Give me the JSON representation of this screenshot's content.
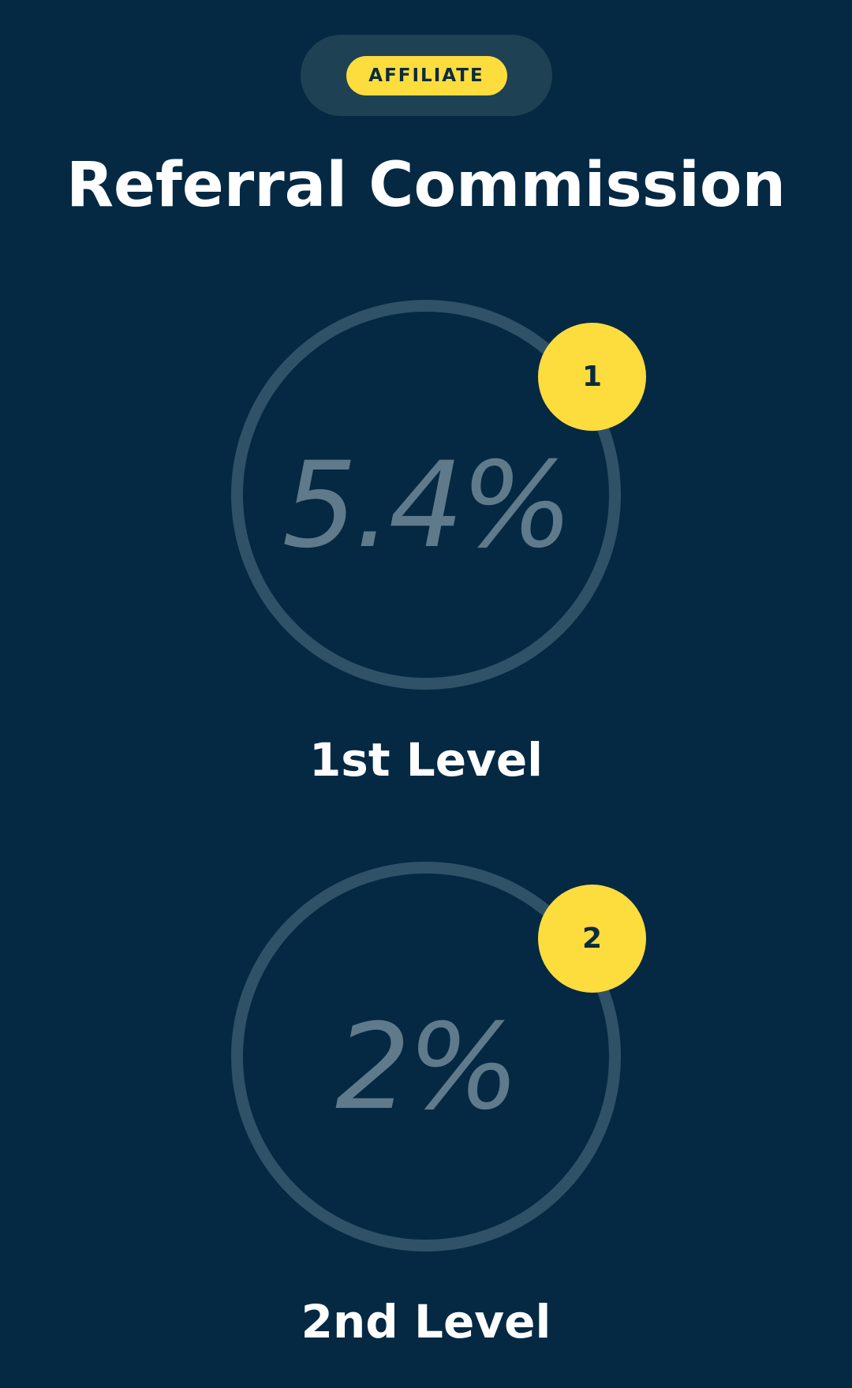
{
  "header": {
    "badge_label": "AFFILIATE",
    "title": "Referral Commission"
  },
  "levels": [
    {
      "number": "1",
      "rate": "5.4%",
      "label": "1st Level"
    },
    {
      "number": "2",
      "rate": "2%",
      "label": "2nd Level"
    }
  ],
  "colors": {
    "background": "#052943",
    "accent": "#fddc3e",
    "ring": "#2f5268",
    "rate_text": "#5f7a8a",
    "pill_bg": "#1e4153"
  }
}
